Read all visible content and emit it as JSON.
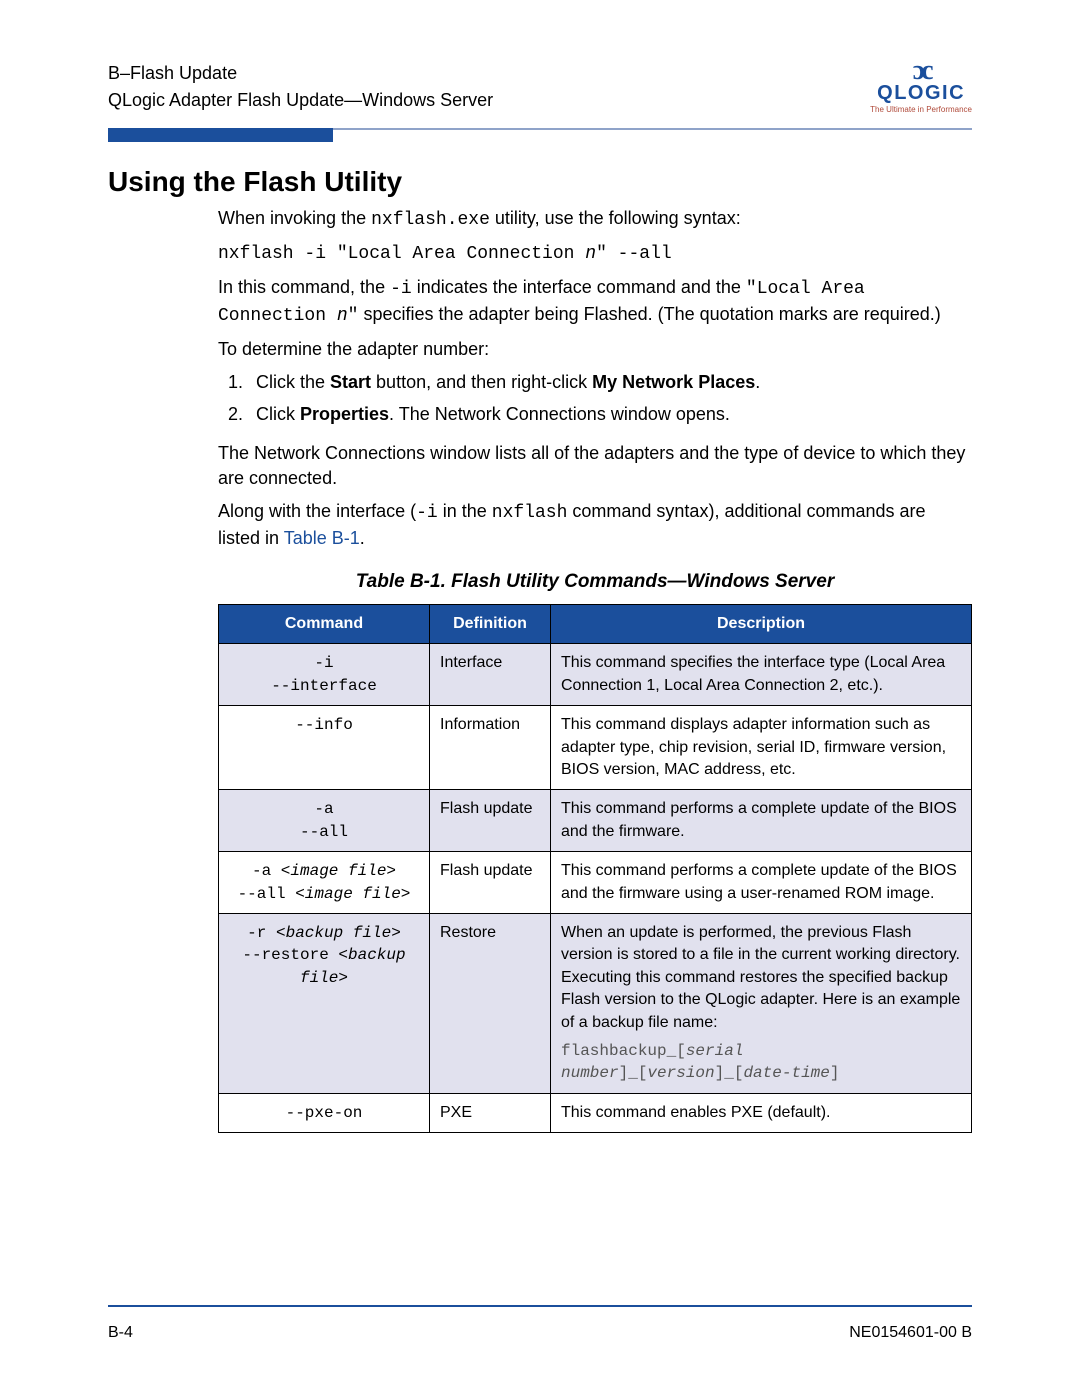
{
  "header": {
    "line1": "B–Flash Update",
    "line2": "QLogic Adapter Flash Update—Windows Server",
    "logo_name": "QLOGIC",
    "logo_tag": "The Ultimate in Performance"
  },
  "section_title": "Using the Flash Utility",
  "intro": {
    "p1_a": "When invoking the ",
    "p1_mono": "nxflash.exe",
    "p1_b": " utility, use the following syntax:",
    "syntax_a": "nxflash -i \"Local Area Connection ",
    "syntax_n": "n",
    "syntax_b": "\" --all",
    "p2_a": "In this command, the ",
    "p2_mono1": "-i",
    "p2_b": " indicates the interface command and the ",
    "p2_mono2": "\"Local Area Connection ",
    "p2_mono2_n": "n",
    "p2_mono2_end": "\"",
    "p2_c": " specifies the adapter being Flashed. (The quotation marks are required.)",
    "p3": "To determine the adapter number:",
    "step1_a": "Click the ",
    "step1_b": "Start",
    "step1_c": " button, and then right-click ",
    "step1_d": "My Network Places",
    "step1_e": ".",
    "step2_a": "Click ",
    "step2_b": "Properties",
    "step2_c": ". The Network Connections window opens.",
    "p4": "The Network Connections window lists all of the adapters and the type of device to which they are connected.",
    "p5_a": "Along with the interface (",
    "p5_mono1": "-i",
    "p5_b": " in the ",
    "p5_mono2": "nxflash",
    "p5_c": " command syntax), additional commands are listed in ",
    "p5_link": "Table B-1",
    "p5_d": "."
  },
  "table": {
    "caption": "Table B-1. Flash Utility Commands—Windows Server",
    "headers": {
      "c1": "Command",
      "c2": "Definition",
      "c3": "Description"
    },
    "rows": [
      {
        "cmd_lines": [
          "-i",
          "--interface"
        ],
        "cmd_italic": [
          false,
          false
        ],
        "def": "Interface",
        "desc": "This command specifies the interface type (Local Area Connection 1, Local Area Connection 2, etc.).",
        "shaded": true
      },
      {
        "cmd_lines": [
          "--info"
        ],
        "cmd_italic": [
          false
        ],
        "def": "Information",
        "desc": "This command displays adapter information such as adapter type, chip revision, serial ID, firmware version, BIOS version, MAC address, etc.",
        "shaded": false
      },
      {
        "cmd_lines": [
          "-a",
          "--all"
        ],
        "cmd_italic": [
          false,
          false
        ],
        "def": "Flash update",
        "desc": "This command performs a complete update of the BIOS and the firmware.",
        "shaded": true
      },
      {
        "cmd_parts": [
          [
            {
              "t": "-a ",
              "i": false
            },
            {
              "t": "<image file>",
              "i": true
            }
          ],
          [
            {
              "t": "--all ",
              "i": false
            },
            {
              "t": "<image file>",
              "i": true
            }
          ]
        ],
        "def": "Flash update",
        "desc": "This command performs a complete update of the BIOS and the firmware using a user-renamed ROM image.",
        "shaded": false
      },
      {
        "cmd_parts": [
          [
            {
              "t": "-r ",
              "i": false
            },
            {
              "t": "<backup file>",
              "i": true
            }
          ],
          [
            {
              "t": "--restore ",
              "i": false
            },
            {
              "t": "<backup file>",
              "i": true
            }
          ]
        ],
        "def": "Restore",
        "desc": "When an update is performed, the previous Flash version is stored to a file in the current working directory. Executing this command restores the specified backup Flash version to the QLogic adapter. Here is an example of a backup file name:",
        "desc_mono_parts": [
          {
            "t": "flashbackup_[",
            "i": false
          },
          {
            "t": "serial number",
            "i": true
          },
          {
            "t": "]_[",
            "i": false
          },
          {
            "t": "version",
            "i": true
          },
          {
            "t": "]_[",
            "i": false
          },
          {
            "t": "date-time",
            "i": true
          },
          {
            "t": "]",
            "i": false
          }
        ],
        "shaded": true
      },
      {
        "cmd_lines": [
          "--pxe-on"
        ],
        "cmd_italic": [
          false
        ],
        "def": "PXE",
        "desc": "This command enables PXE (default).",
        "shaded": false
      }
    ]
  },
  "footer": {
    "left": "B-4",
    "right": "NE0154601-00  B"
  }
}
